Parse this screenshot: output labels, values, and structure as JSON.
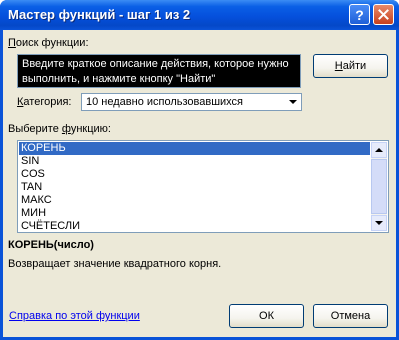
{
  "window": {
    "title": "Мастер функций - шаг 1 из 2",
    "help_glyph": "?"
  },
  "search": {
    "label_prefix": "",
    "label_underlined": "П",
    "label_rest": "оиск функции:",
    "text": "Введите краткое описание действия, которое нужно выполнить, и нажмите кнопку \"Найти\"",
    "find_button_prefix": "",
    "find_button_underlined": "Н",
    "find_button_rest": "айти"
  },
  "category": {
    "label_prefix": "",
    "label_underlined": "К",
    "label_rest": "атегория:",
    "selected": "10 недавно использовавшихся"
  },
  "function_list": {
    "label_prefix": "Выберите ",
    "label_underlined": "ф",
    "label_rest": "ункцию:",
    "items": [
      "КОРЕНЬ",
      "SIN",
      "COS",
      "TAN",
      "МАКС",
      "МИН",
      "СЧЁТЕСЛИ"
    ],
    "selected_index": 0
  },
  "details": {
    "signature": "КОРЕНЬ(число)",
    "description": "Возвращает значение квадратного корня."
  },
  "footer": {
    "help_link": "Справка по этой функции",
    "ok_label": "ОК",
    "cancel_label": "Отмена"
  },
  "colors": {
    "titlebar": "#0550dc",
    "selection": "#316ac5",
    "dialog_face": "#ece9d8",
    "link": "#0000ee"
  },
  "icons": {
    "help": "help-icon",
    "close": "close-icon",
    "dropdown": "chevron-down-icon",
    "scroll_up": "scroll-up-icon",
    "scroll_down": "scroll-down-icon"
  }
}
